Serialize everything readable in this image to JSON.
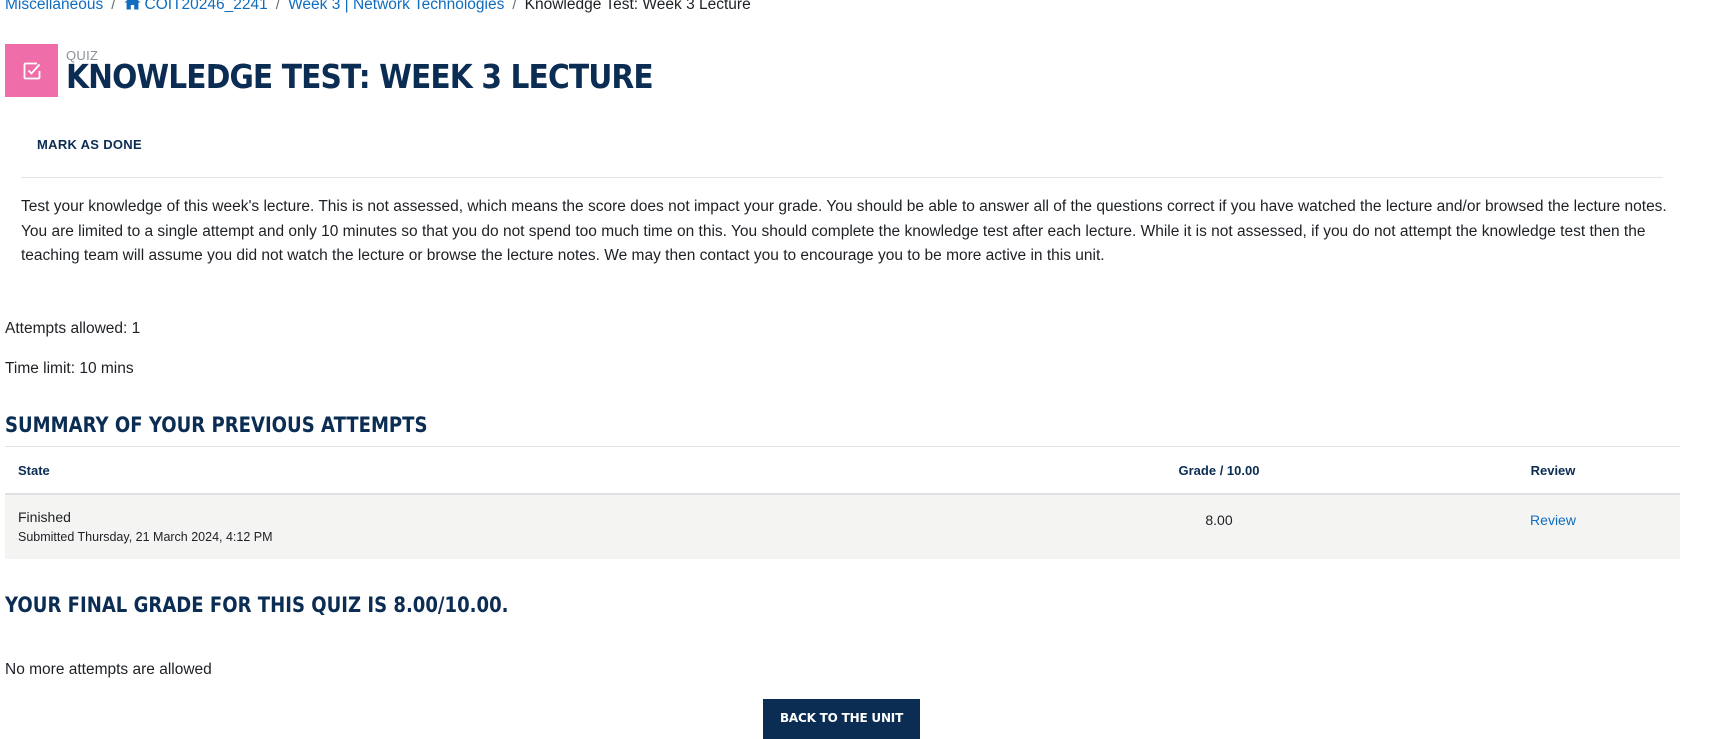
{
  "breadcrumb": {
    "items": [
      {
        "label": "Miscellaneous"
      },
      {
        "label": "COIT20246_2241",
        "icon": "home-icon"
      },
      {
        "label": "Week 3 | Network Technologies"
      }
    ],
    "current": "Knowledge Test: Week 3 Lecture",
    "separator": "/"
  },
  "header": {
    "activity_type": "QUIZ",
    "activity_icon": "quiz-checkbox-icon",
    "icon_color": "#ef6eaa",
    "title": "KNOWLEDGE TEST: WEEK 3 LECTURE"
  },
  "actions": {
    "mark_done_label": "MARK AS DONE"
  },
  "intro": {
    "text": "Test your knowledge of this week's lecture. This is not assessed, which means the score does not impact your grade. You should be able to answer all of the questions correct if you have watched the lecture and/or browsed the lecture notes. You are limited to a single attempt and only 10 minutes so that you do not spend too much time on this. You should complete the knowledge test after each lecture. While it is not assessed, if you do not attempt the knowledge test then the teaching team will assume you did not watch the lecture or browse the lecture notes. We may then contact you to encourage you to be more active in this unit."
  },
  "quiz_info": {
    "attempts_allowed": "Attempts allowed: 1",
    "time_limit": "Time limit: 10 mins"
  },
  "summary": {
    "heading": "SUMMARY OF YOUR PREVIOUS ATTEMPTS",
    "columns": {
      "state": "State",
      "grade": "Grade / 10.00",
      "review": "Review"
    },
    "rows": [
      {
        "state": "Finished",
        "submitted": "Submitted Thursday, 21 March 2024, 4:12 PM",
        "grade": "8.00",
        "review": "Review"
      }
    ]
  },
  "final_grade": "YOUR FINAL GRADE FOR THIS QUIZ IS 8.00/10.00.",
  "no_more_attempts": "No more attempts are allowed",
  "back_button_label": "BACK TO THE UNIT",
  "colors": {
    "link": "#0f6cbf",
    "heading": "#0b2d53",
    "row_background": "#f4f4f2"
  }
}
